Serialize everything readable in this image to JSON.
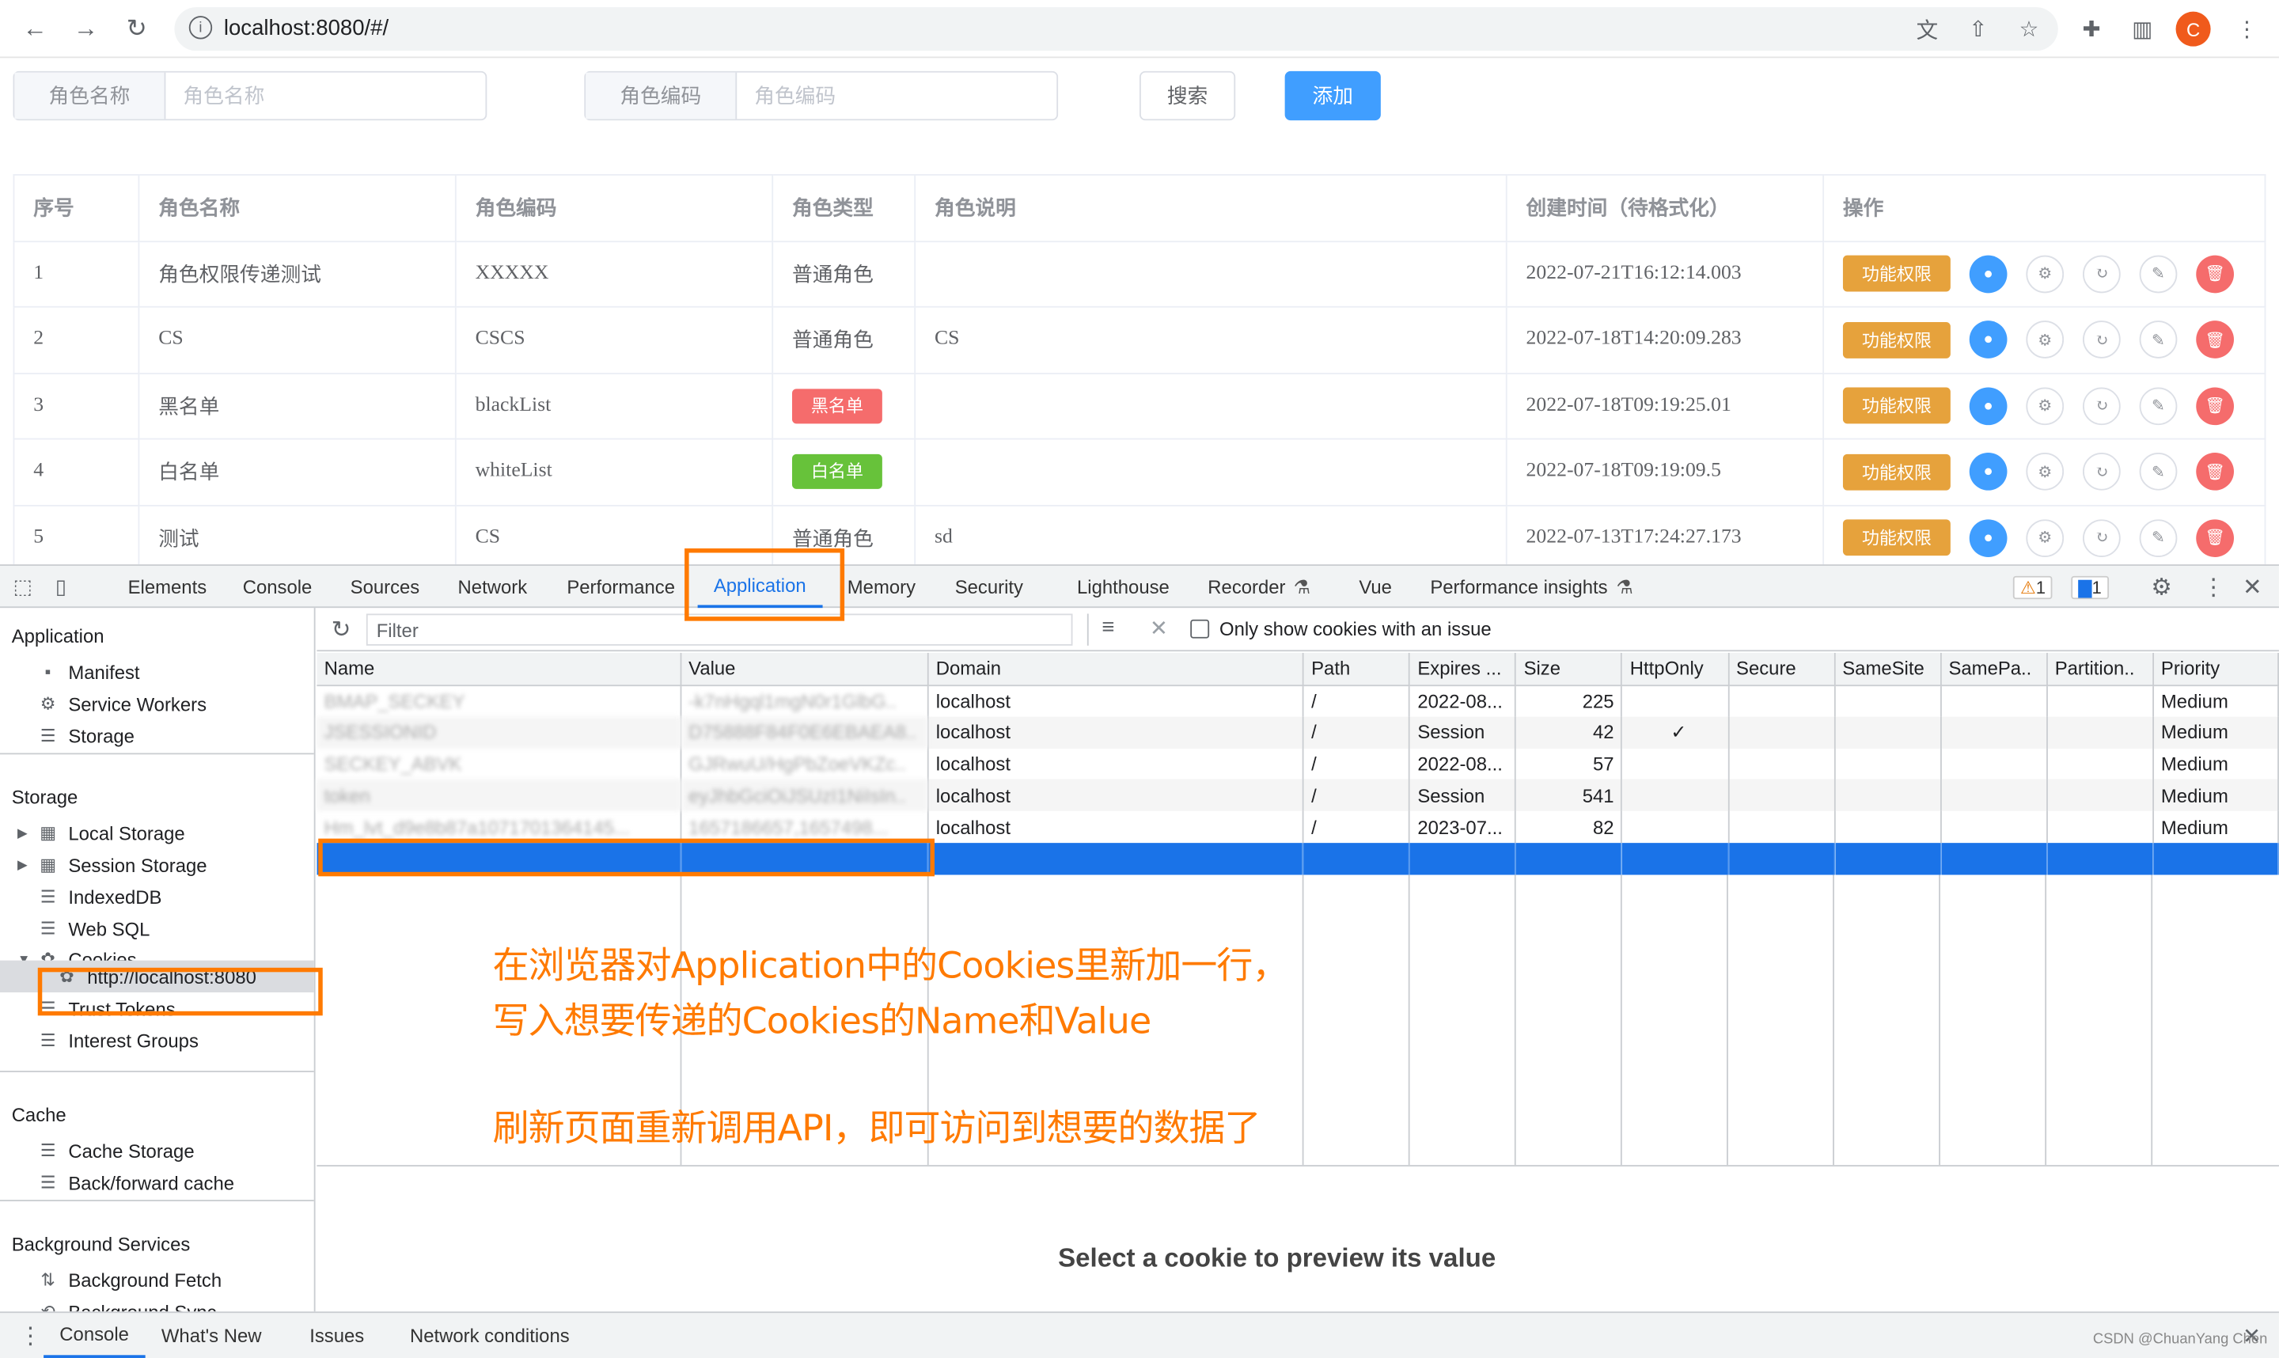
{
  "browser": {
    "url": "localhost:8080/#/",
    "avatar_letter": "C"
  },
  "search": {
    "role_name_label": "角色名称",
    "role_name_placeholder": "角色名称",
    "role_code_label": "角色编码",
    "role_code_placeholder": "角色编码",
    "search_btn": "搜索",
    "add_btn": "添加"
  },
  "table": {
    "headers": [
      "序号",
      "角色名称",
      "角色编码",
      "角色类型",
      "角色说明",
      "创建时间（待格式化）",
      "操作"
    ],
    "rows": [
      {
        "no": "1",
        "name": "角色权限传递测试",
        "code": "XXXXX",
        "type": "普通角色",
        "desc": "",
        "created": "2022-07-21T16:12:14.003"
      },
      {
        "no": "2",
        "name": "CS",
        "code": "CSCS",
        "type": "普通角色",
        "desc": "CS",
        "created": "2022-07-18T14:20:09.283"
      },
      {
        "no": "3",
        "name": "黑名单",
        "code": "blackList",
        "type": "黑名单",
        "type_color": "#f56c6c",
        "desc": "",
        "created": "2022-07-18T09:19:25.01"
      },
      {
        "no": "4",
        "name": "白名单",
        "code": "whiteList",
        "type": "白名单",
        "type_color": "#67c23a",
        "desc": "",
        "created": "2022-07-18T09:19:09.5"
      },
      {
        "no": "5",
        "name": "测试",
        "code": "CS",
        "type": "普通角色",
        "desc": "sd",
        "created": "2022-07-13T17:24:27.173"
      }
    ],
    "perm_btn": "功能权限"
  },
  "devtools": {
    "tabs": [
      "Elements",
      "Console",
      "Sources",
      "Network",
      "Performance",
      "Application",
      "Memory",
      "Security",
      "Lighthouse",
      "Recorder",
      "Vue",
      "Performance insights"
    ],
    "active_tab": "Application",
    "warn_count": "1",
    "msg_count": "1",
    "sidebar": {
      "application_title": "Application",
      "manifest": "Manifest",
      "service_workers": "Service Workers",
      "storage_item": "Storage",
      "storage_title": "Storage",
      "local_storage": "Local Storage",
      "session_storage": "Session Storage",
      "indexeddb": "IndexedDB",
      "websql": "Web SQL",
      "cookies": "Cookies",
      "cookie_origin": "http://localhost:8080",
      "trust_tokens": "Trust Tokens",
      "interest_groups": "Interest Groups",
      "cache_title": "Cache",
      "cache_storage": "Cache Storage",
      "bfcache": "Back/forward cache",
      "bg_title": "Background Services",
      "bg_fetch": "Background Fetch",
      "bg_sync": "Background Sync"
    },
    "filter_placeholder": "Filter",
    "only_issue_label": "Only show cookies with an issue",
    "columns": [
      "Name",
      "Value",
      "Domain",
      "Path",
      "Expires ...",
      "Size",
      "HttpOnly",
      "Secure",
      "SameSite",
      "SamePa..",
      "Partition..",
      "Priority"
    ],
    "cookies": [
      {
        "name": "BMAP_SECKEY",
        "value": "-k7nHgql1mgN0r1GlbG..",
        "domain": "localhost",
        "path": "/",
        "expires": "2022-08...",
        "size": "225",
        "httponly": "",
        "priority": "Medium"
      },
      {
        "name": "JSESSIONID",
        "value": "D75888F84F0E6EBAEA8..",
        "domain": "localhost",
        "path": "/",
        "expires": "Session",
        "size": "42",
        "httponly": "✓",
        "priority": "Medium"
      },
      {
        "name": "SECKEY_ABVK",
        "value": "GJRwuU/HgPbZoeVKZc..",
        "domain": "localhost",
        "path": "/",
        "expires": "2022-08...",
        "size": "57",
        "httponly": "",
        "priority": "Medium"
      },
      {
        "name": "token",
        "value": "eyJhbGciOiJSUzI1NiIsIn..",
        "domain": "localhost",
        "path": "/",
        "expires": "Session",
        "size": "541",
        "httponly": "",
        "priority": "Medium"
      },
      {
        "name": "Hm_lvt_d9e8b87a1071701364145...",
        "value": "1657186657,1657498...",
        "domain": "localhost",
        "path": "/",
        "expires": "2023-07...",
        "size": "82",
        "httponly": "",
        "priority": "Medium"
      }
    ],
    "preview_text": "Select a cookie to preview its value",
    "bottom_tabs": [
      "Console",
      "What's New",
      "Issues",
      "Network conditions"
    ]
  },
  "annotations": {
    "line1": "在浏览器对Application中的Cookies里新加一行，",
    "line2": "写入想要传递的Cookies的Name和Value",
    "line3": "刷新页面重新调用API，即可访问到想要的数据了"
  },
  "watermark": "CSDN @ChuanYang Chen",
  "colors": {
    "accent": "#409eff",
    "warning": "#e6a23c",
    "danger": "#f56c6c",
    "success": "#67c23a",
    "annotation": "#ff7a00",
    "devtools_select": "#1a73e8"
  }
}
